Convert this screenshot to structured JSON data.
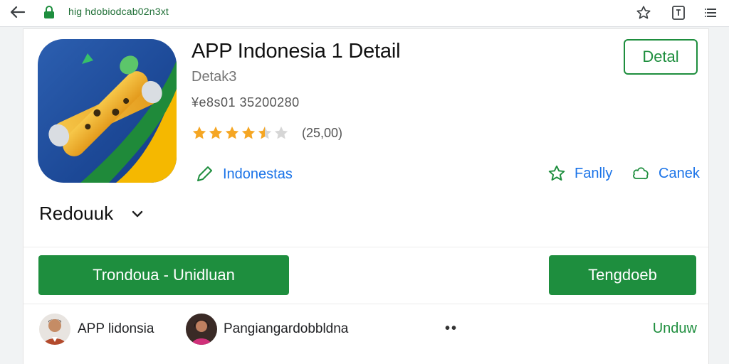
{
  "browser": {
    "url": "hig hdobiodcab02n3xt",
    "icons": [
      "back-arrow-icon",
      "lock-icon",
      "star-icon",
      "reader-icon",
      "menu-icon"
    ]
  },
  "app": {
    "title": "APP Indonesia 1 Detail",
    "subtitle": "Detak3",
    "meta": "¥e8s01 35200280",
    "rating_stars": 4.5,
    "rating_max": 5,
    "rating_count": "(25,00)",
    "detail_button": "Detal"
  },
  "links": {
    "left_label": "Indonestas",
    "family_label": "Fanlly",
    "cancel_label": "Canek"
  },
  "section": {
    "title": "Redouuk"
  },
  "actions": {
    "primary_label": "Trondoua - Unidluan",
    "secondary_label": "Tengdoeb"
  },
  "developers": {
    "first_name": "APP lidonsia",
    "second_name": "Pangiangardobbldna",
    "more": "••",
    "download_label": "Unduw"
  },
  "colors": {
    "accent_green": "#1e8e3e",
    "link_blue": "#1a73e8",
    "star_gold": "#f5a623"
  }
}
